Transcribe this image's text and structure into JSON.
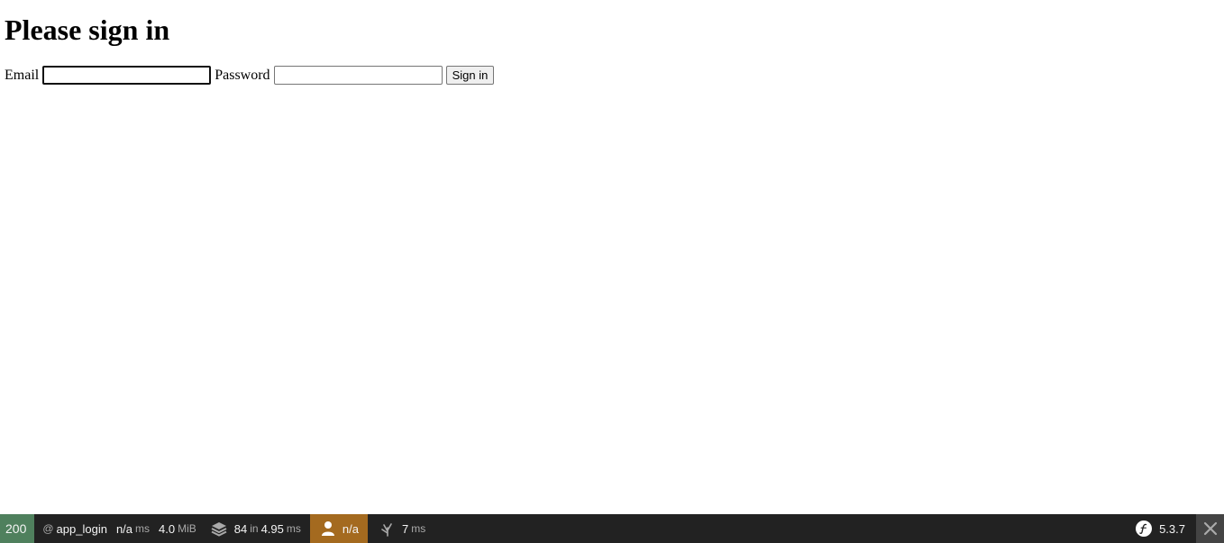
{
  "page": {
    "title": "Please sign in",
    "email_label": "Email",
    "email_value": "",
    "password_label": "Password",
    "password_value": "",
    "submit_label": "Sign in"
  },
  "toolbar": {
    "status_code": "200",
    "route_prefix": "@",
    "route": "app_login",
    "request_time_value": "n/a",
    "request_time_unit": "ms",
    "memory_value": "4.0",
    "memory_unit": "MiB",
    "twig_count": "84",
    "twig_in": "in",
    "twig_time": "4.95",
    "twig_unit": "ms",
    "user": "n/a",
    "init_time_value": "7",
    "init_time_unit": "ms",
    "symfony_version": "5.3.7",
    "colors": {
      "status_ok": "#4f805d",
      "user_warning": "#a46a1f",
      "bar": "#222222"
    },
    "icons": [
      "twig-layers-icon",
      "user-icon",
      "time-icon",
      "symfony-logo-icon",
      "close-icon"
    ]
  }
}
